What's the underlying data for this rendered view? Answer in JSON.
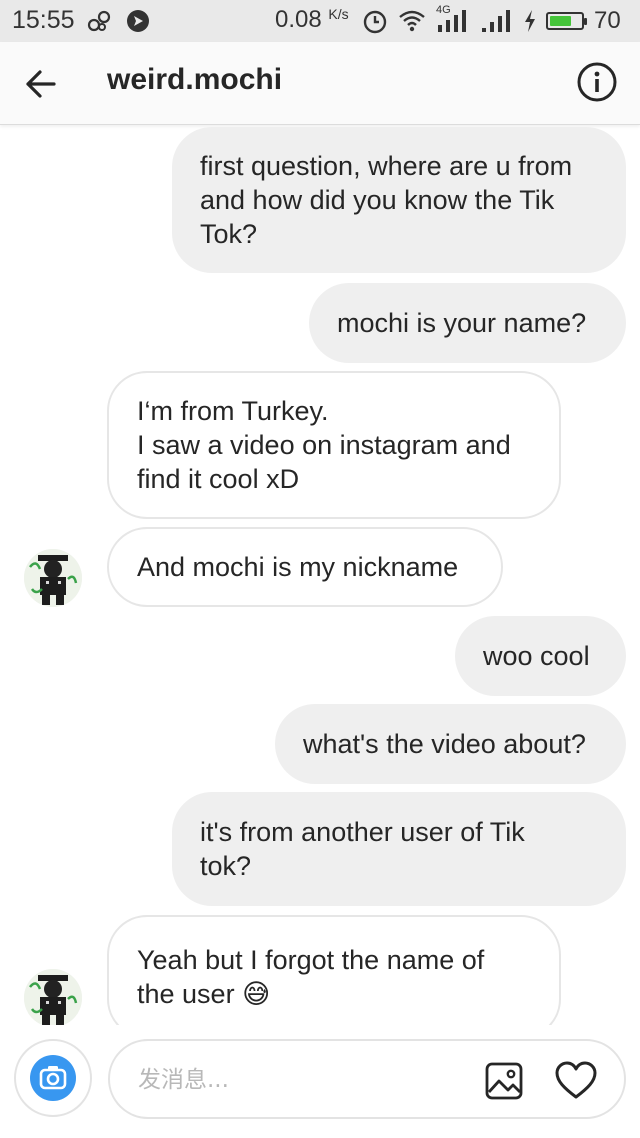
{
  "status_bar": {
    "time": "15:55",
    "speed_value": "0.08",
    "speed_unit": "K/s",
    "network_label": "4G",
    "battery_level": "70",
    "battery_color": "#45c43a"
  },
  "header": {
    "title": "weird.mochi",
    "back_icon": "arrow-left-icon",
    "info_icon": "info-circle-icon"
  },
  "messages": [
    {
      "direction": "out",
      "text": "first question, where are u from\nand how did you know the Tik\nTok?"
    },
    {
      "direction": "out",
      "text": "mochi is your name?"
    },
    {
      "direction": "in",
      "text": "I‘m from Turkey.\nI saw a video on instagram and\nfind it cool xD",
      "avatar": false
    },
    {
      "direction": "in",
      "text": "And mochi is my nickname",
      "avatar": true
    },
    {
      "direction": "out",
      "text": "woo cool"
    },
    {
      "direction": "out",
      "text": "what's the video about?"
    },
    {
      "direction": "out",
      "text": "it's from another user of Tik\ntok?"
    },
    {
      "direction": "in",
      "text": "Yeah but I forgot the name of\nthe user",
      "emoji": "😅",
      "avatar": true
    }
  ],
  "composer": {
    "placeholder": "发消息...",
    "camera_icon": "camera-icon",
    "gallery_icon": "image-gallery-icon",
    "like_icon": "heart-icon",
    "accent_color": "#3897f0"
  }
}
